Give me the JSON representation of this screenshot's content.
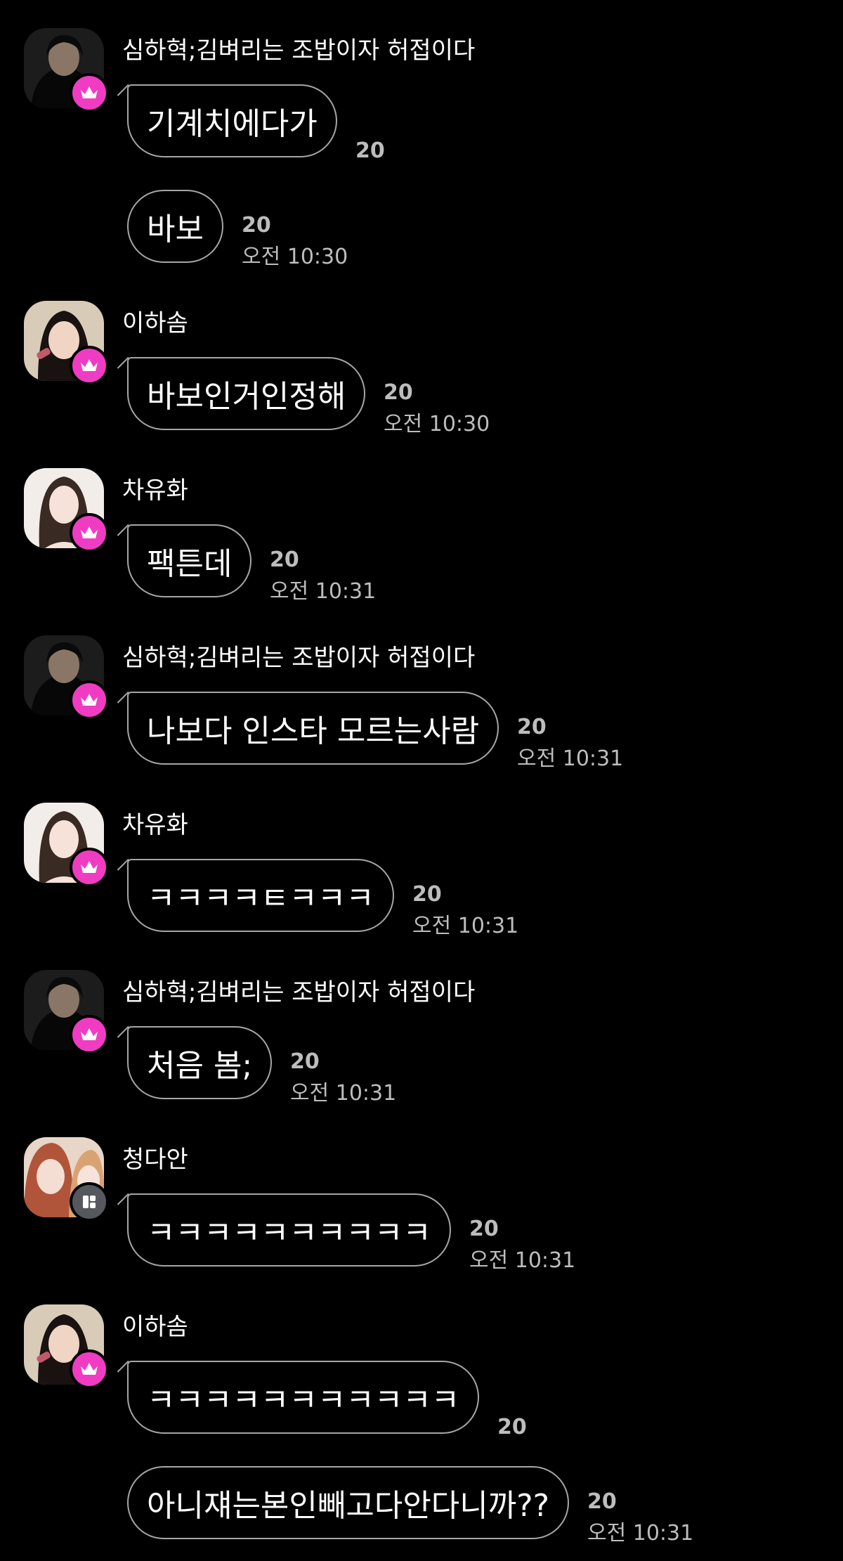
{
  "colors": {
    "background": "#000000",
    "badge_crown": "#f03cc3",
    "badge_other": "#55595f",
    "bubble_border": "#a6a6a6",
    "meta_text": "#bdbdbd"
  },
  "groups": [
    {
      "sender": "심하혁;김벼리는 조밥이자 허접이다",
      "avatar_icon": "avatar-hooded-man",
      "badge_icon": "crown-icon",
      "messages": [
        {
          "text": "기계치에다가",
          "count": "20",
          "time": ""
        },
        {
          "text": "바보",
          "count": "20",
          "time": "오전 10:30"
        }
      ]
    },
    {
      "sender": "이하솜",
      "avatar_icon": "avatar-girl-snack",
      "badge_icon": "crown-icon",
      "messages": [
        {
          "text": "바보인거인정해",
          "count": "20",
          "time": "오전 10:30"
        }
      ]
    },
    {
      "sender": "차유화",
      "avatar_icon": "avatar-girl-long-hair",
      "badge_icon": "crown-icon",
      "messages": [
        {
          "text": "팩튼데",
          "count": "20",
          "time": "오전 10:31"
        }
      ]
    },
    {
      "sender": "심하혁;김벼리는 조밥이자 허접이다",
      "avatar_icon": "avatar-hooded-man",
      "badge_icon": "crown-icon",
      "messages": [
        {
          "text": "나보다 인스타 모르는사람",
          "count": "20",
          "time": "오전 10:31"
        }
      ]
    },
    {
      "sender": "차유화",
      "avatar_icon": "avatar-girl-long-hair",
      "badge_icon": "crown-icon",
      "messages": [
        {
          "text": "ㅋㅋㅋㅋㅌㅋㅋㅋ",
          "count": "20",
          "time": "오전 10:31"
        }
      ]
    },
    {
      "sender": "심하혁;김벼리는 조밥이자 허접이다",
      "avatar_icon": "avatar-hooded-man",
      "badge_icon": "crown-icon",
      "messages": [
        {
          "text": "처음 봄;",
          "count": "20",
          "time": "오전 10:31"
        }
      ]
    },
    {
      "sender": "청다안",
      "avatar_icon": "avatar-two-girls",
      "badge_icon": "app-badge-icon",
      "messages": [
        {
          "text": "ㅋㅋㅋㅋㅋㅋㅋㅋㅋㅋ",
          "count": "20",
          "time": "오전 10:31"
        }
      ]
    },
    {
      "sender": "이하솜",
      "avatar_icon": "avatar-girl-snack",
      "badge_icon": "crown-icon",
      "messages": [
        {
          "text": "ㅋㅋㅋㅋㅋㅋㅋㅋㅋㅋㅋ",
          "count": "20",
          "time": ""
        },
        {
          "text": "아니쟤는본인빼고다안다니까??",
          "count": "20",
          "time": "오전 10:31"
        }
      ]
    }
  ]
}
